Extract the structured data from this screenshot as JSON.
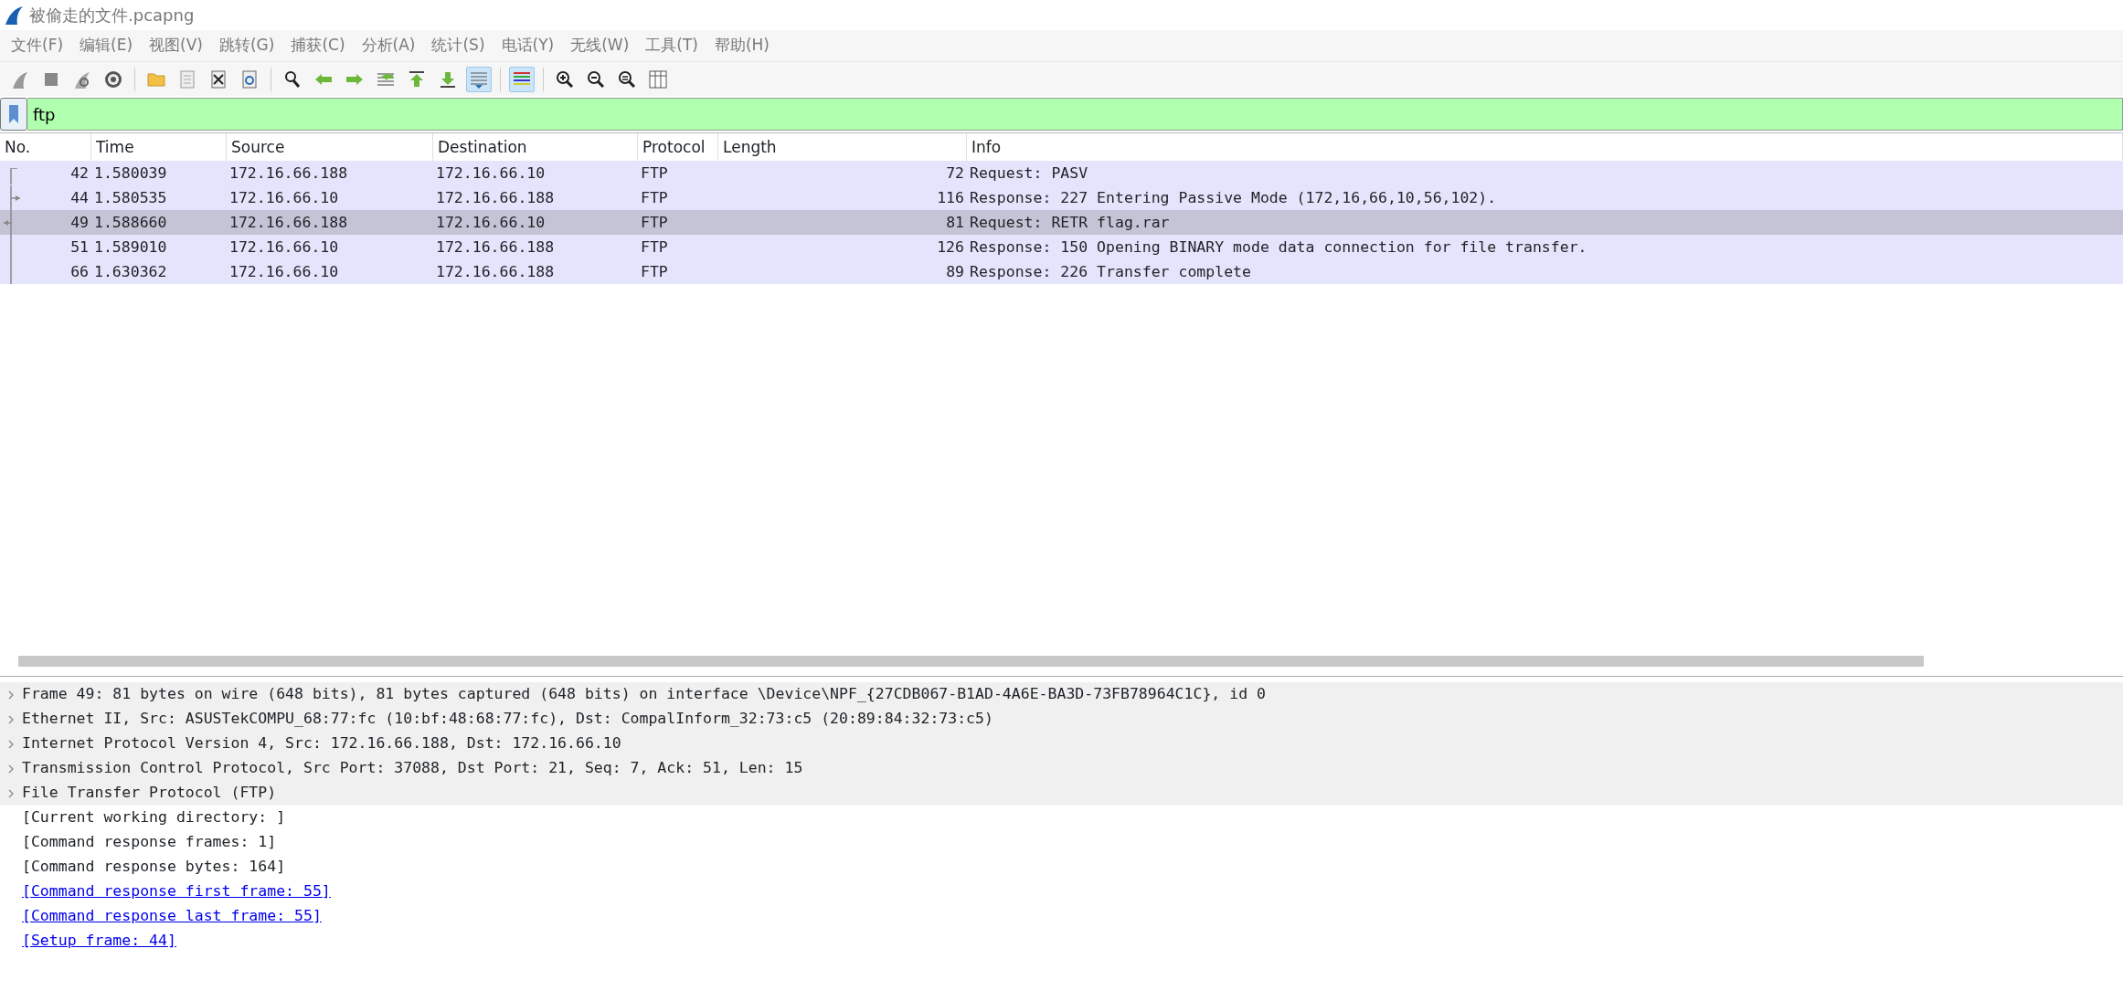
{
  "window": {
    "title": "被偷走的文件.pcapng"
  },
  "menu": [
    "文件(F)",
    "编辑(E)",
    "视图(V)",
    "跳转(G)",
    "捕获(C)",
    "分析(A)",
    "统计(S)",
    "电话(Y)",
    "无线(W)",
    "工具(T)",
    "帮助(H)"
  ],
  "toolbar": [
    {
      "kind": "start",
      "pressed": false
    },
    {
      "kind": "stop",
      "pressed": false
    },
    {
      "kind": "restart",
      "pressed": false
    },
    {
      "kind": "options",
      "pressed": false
    },
    {
      "kind": "separator"
    },
    {
      "kind": "open",
      "pressed": false
    },
    {
      "kind": "file",
      "pressed": false
    },
    {
      "kind": "close",
      "pressed": false
    },
    {
      "kind": "reload",
      "pressed": false
    },
    {
      "kind": "separator"
    },
    {
      "kind": "find",
      "pressed": false
    },
    {
      "kind": "back",
      "pressed": false
    },
    {
      "kind": "forward",
      "pressed": false
    },
    {
      "kind": "goto",
      "pressed": false
    },
    {
      "kind": "first",
      "pressed": false
    },
    {
      "kind": "last",
      "pressed": false
    },
    {
      "kind": "autoscroll",
      "pressed": true
    },
    {
      "kind": "separator"
    },
    {
      "kind": "colorize",
      "pressed": true
    },
    {
      "kind": "separator"
    },
    {
      "kind": "zoomin",
      "pressed": false
    },
    {
      "kind": "zoomout",
      "pressed": false
    },
    {
      "kind": "zoomreset",
      "pressed": false
    },
    {
      "kind": "resize",
      "pressed": false
    }
  ],
  "filter": {
    "value": "ftp"
  },
  "packet_list": {
    "columns": [
      "No.",
      "Time",
      "Source",
      "Destination",
      "Protocol",
      "Length",
      "Info"
    ],
    "rows": [
      {
        "kind": "start",
        "selected": false,
        "cells": [
          "42",
          "1.580039",
          "172.16.66.188",
          "172.16.66.10",
          "FTP",
          "72",
          "Request: PASV"
        ]
      },
      {
        "kind": "response",
        "selected": false,
        "cells": [
          "44",
          "1.580535",
          "172.16.66.10",
          "172.16.66.188",
          "FTP",
          "116",
          "Response: 227 Entering Passive Mode (172,16,66,10,56,102)."
        ]
      },
      {
        "kind": "request",
        "selected": true,
        "cells": [
          "49",
          "1.588660",
          "172.16.66.188",
          "172.16.66.10",
          "FTP",
          "81",
          "Request: RETR flag.rar"
        ]
      },
      {
        "kind": "line",
        "selected": false,
        "cells": [
          "51",
          "1.589010",
          "172.16.66.10",
          "172.16.66.188",
          "FTP",
          "126",
          "Response: 150 Opening BINARY mode data connection for file transfer."
        ]
      },
      {
        "kind": "end",
        "selected": false,
        "cells": [
          "66",
          "1.630362",
          "172.16.66.10",
          "172.16.66.188",
          "FTP",
          "89",
          "Response: 226 Transfer complete"
        ]
      }
    ]
  },
  "details": [
    {
      "kind": "tree",
      "text": "Frame 49: 81 bytes on wire (648 bits), 81 bytes captured (648 bits) on interface \\Device\\NPF_{27CDB067-B1AD-4A6E-BA3D-73FB78964C1C}, id 0"
    },
    {
      "kind": "tree",
      "text": "Ethernet II, Src: ASUSTekCOMPU_68:77:fc (10:bf:48:68:77:fc), Dst: CompalInform_32:73:c5 (20:89:84:32:73:c5)"
    },
    {
      "kind": "tree",
      "text": "Internet Protocol Version 4, Src: 172.16.66.188, Dst: 172.16.66.10"
    },
    {
      "kind": "tree",
      "text": "Transmission Control Protocol, Src Port: 37088, Dst Port: 21, Seq: 7, Ack: 51, Len: 15"
    },
    {
      "kind": "tree",
      "text": "File Transfer Protocol (FTP)"
    },
    {
      "kind": "text",
      "text": "[Current working directory: ]"
    },
    {
      "kind": "text",
      "text": "[Command response frames: 1]"
    },
    {
      "kind": "text",
      "text": "[Command response bytes: 164]"
    },
    {
      "kind": "link",
      "text": "[Command response first frame: 55]"
    },
    {
      "kind": "link",
      "text": "[Command response last frame: 55]"
    },
    {
      "kind": "link",
      "text": "[Setup frame: 44]"
    }
  ]
}
